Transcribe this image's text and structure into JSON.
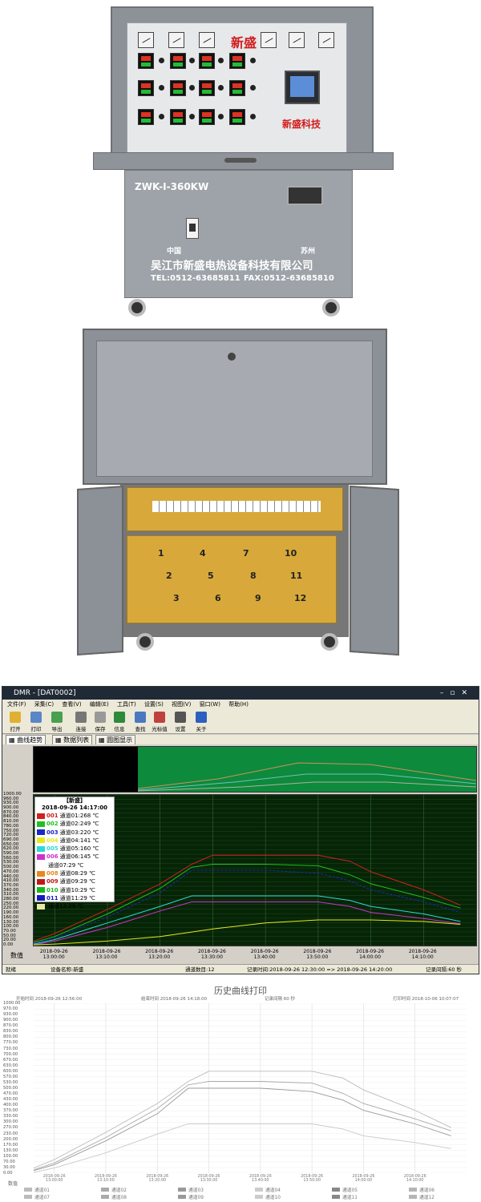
{
  "product": {
    "brand_tag": "新盛",
    "brand_panel": "新盛科技",
    "model": "ZWK-I-360KW",
    "origin_left": "中国",
    "origin_right": "苏州",
    "company": "吴江市新盛电热设备科技有限公司",
    "tel": "TEL:0512-63685811",
    "fax": "FAX:0512-63685810",
    "bay_numbers": [
      "1",
      "2",
      "3",
      "4",
      "5",
      "6",
      "7",
      "8",
      "9",
      "10",
      "11",
      "12"
    ]
  },
  "window": {
    "title": "DMR - [DAT0002]",
    "menus": [
      "文件(F)",
      "采集(C)",
      "查看(V)",
      "编辑(E)",
      "工具(T)",
      "设置(S)",
      "视图(V)",
      "窗口(W)",
      "帮助(H)"
    ],
    "toolbar": [
      {
        "label": "打开",
        "icon": "folder-open-icon",
        "color": "#e0b030"
      },
      {
        "label": "打印",
        "icon": "printer-icon",
        "color": "#5a86c8"
      },
      {
        "label": "导出",
        "icon": "export-icon",
        "color": "#48a050"
      },
      {
        "label": "连接",
        "icon": "connect-icon",
        "color": "#777777"
      },
      {
        "label": "保存",
        "icon": "save-icon",
        "color": "#999999"
      },
      {
        "label": "信息",
        "icon": "check-icon",
        "color": "#2c8a3a"
      },
      {
        "label": "查找",
        "icon": "search-icon",
        "color": "#4a78c0"
      },
      {
        "label": "光标值",
        "icon": "cursor-value-icon",
        "color": "#c04040"
      },
      {
        "label": "设置",
        "icon": "tools-icon",
        "color": "#555555"
      },
      {
        "label": "关于",
        "icon": "help-icon",
        "color": "#2d5fc0"
      }
    ],
    "tabs": [
      "曲线趋势",
      "数据列表",
      "圆图显示"
    ],
    "legend": {
      "title": "【新盛】",
      "time": "2018-09-26 14:17:00",
      "rows": [
        {
          "id": "001",
          "text": "通道01:268 ℃",
          "color": "#d02020"
        },
        {
          "id": "002",
          "text": "通道02:249 ℃",
          "color": "#20c020"
        },
        {
          "id": "003",
          "text": "通道03:220 ℃",
          "color": "#1828c8"
        },
        {
          "id": "004",
          "text": "通道04:141 ℃",
          "color": "#e8e820"
        },
        {
          "id": "005",
          "text": "通道05:160 ℃",
          "color": "#30d8d8"
        },
        {
          "id": "006",
          "text": "通道06:145 ℃",
          "color": "#d030d0"
        },
        {
          "id": "",
          "text": "通道07:29 ℃",
          "color": "#ffffff"
        },
        {
          "id": "008",
          "text": "通道08:29 ℃",
          "color": "#e88820"
        },
        {
          "id": "009",
          "text": "通道09:29 ℃",
          "color": "#c01818"
        },
        {
          "id": "010",
          "text": "通道10:29 ℃",
          "color": "#18b818"
        },
        {
          "id": "011",
          "text": "通道11:29 ℃",
          "color": "#1818c0"
        },
        {
          "id": "",
          "text": "通道12:29 ℃",
          "color": "#e8e8a0"
        }
      ]
    },
    "y_label": "数值",
    "status": {
      "ready": "就绪",
      "device": "设备名称:新盛",
      "channels": "通道数目:12",
      "record_time": "记录时间:2018-09-26 12:30:00 => 2018-09-26 14:20:00",
      "interval": "记录间隔:60 秒"
    }
  },
  "chart_data": [
    {
      "type": "line",
      "title": "",
      "ylabel": "数值",
      "ylim": [
        0,
        1000
      ],
      "y_ticks": [
        "1000.00",
        "960.00",
        "930.00",
        "900.00",
        "870.00",
        "840.00",
        "810.00",
        "780.00",
        "750.00",
        "720.00",
        "690.00",
        "650.00",
        "620.00",
        "590.00",
        "560.00",
        "530.00",
        "500.00",
        "470.00",
        "440.00",
        "410.00",
        "370.00",
        "340.00",
        "310.00",
        "280.00",
        "250.00",
        "220.00",
        "190.00",
        "160.00",
        "130.00",
        "100.00",
        "70.00",
        "50.00",
        "20.00",
        "0.00"
      ],
      "x_ticks": [
        {
          "d": "2018-09-26",
          "t": "13:00:00"
        },
        {
          "d": "2018-09-26",
          "t": "13:10:00"
        },
        {
          "d": "2018-09-26",
          "t": "13:20:00"
        },
        {
          "d": "2018-09-26",
          "t": "13:30:00"
        },
        {
          "d": "2018-09-26",
          "t": "13:40:00"
        },
        {
          "d": "2018-09-26",
          "t": "13:50:00"
        },
        {
          "d": "2018-09-26",
          "t": "14:00:00"
        },
        {
          "d": "2018-09-26",
          "t": "14:10:00"
        }
      ],
      "x": [
        "12:56",
        "13:00",
        "13:10",
        "13:20",
        "13:26",
        "13:30",
        "13:40",
        "13:50",
        "13:56",
        "14:00",
        "14:10",
        "14:17"
      ],
      "series": [
        {
          "color": "#d02020",
          "values": [
            30,
            80,
            240,
            410,
            540,
            600,
            600,
            600,
            560,
            490,
            370,
            268
          ]
        },
        {
          "color": "#20c020",
          "values": [
            20,
            60,
            210,
            380,
            520,
            540,
            540,
            530,
            470,
            410,
            320,
            249
          ]
        },
        {
          "color": "#1828c8",
          "values": [
            15,
            50,
            190,
            350,
            500,
            500,
            500,
            480,
            430,
            370,
            290,
            220
          ]
        },
        {
          "color": "#30d8d8",
          "values": [
            10,
            40,
            150,
            260,
            330,
            330,
            330,
            330,
            300,
            260,
            210,
            160
          ]
        },
        {
          "color": "#d030d0",
          "values": [
            5,
            30,
            120,
            230,
            290,
            290,
            290,
            290,
            260,
            220,
            180,
            145
          ]
        },
        {
          "color": "#e8e820",
          "values": [
            5,
            10,
            30,
            60,
            90,
            110,
            150,
            170,
            170,
            170,
            160,
            141
          ]
        }
      ]
    },
    {
      "type": "line",
      "title": "历史曲线打印",
      "ylim": [
        0,
        1000
      ],
      "y_ticks": [
        "1000.00",
        "970.00",
        "930.00",
        "900.00",
        "870.00",
        "830.00",
        "800.00",
        "770.00",
        "730.00",
        "700.00",
        "670.00",
        "630.00",
        "600.00",
        "570.00",
        "530.00",
        "500.00",
        "470.00",
        "430.00",
        "400.00",
        "370.00",
        "330.00",
        "300.00",
        "270.00",
        "230.00",
        "200.00",
        "170.00",
        "130.00",
        "100.00",
        "70.00",
        "30.00",
        "0.00"
      ],
      "x_ticks": [
        "2018-09-26 13:00:00",
        "2018-09-26 13:10:00",
        "2018-09-26 13:20:00",
        "2018-09-26 13:30:00",
        "2018-09-26 13:40:00",
        "2018-09-26 13:50:00",
        "2018-09-26 14:00:00",
        "2018-09-26 14:10:00"
      ],
      "x": [
        "12:56",
        "13:00",
        "13:10",
        "13:20",
        "13:26",
        "13:30",
        "13:40",
        "13:50",
        "13:56",
        "14:00",
        "14:10",
        "14:17"
      ],
      "series": [
        {
          "color": "#bbbbbb",
          "values": [
            30,
            80,
            240,
            410,
            540,
            600,
            600,
            600,
            560,
            490,
            370,
            268
          ]
        },
        {
          "color": "#aaaaaa",
          "values": [
            20,
            60,
            210,
            380,
            520,
            540,
            540,
            530,
            470,
            410,
            320,
            249
          ]
        },
        {
          "color": "#999999",
          "values": [
            15,
            50,
            190,
            350,
            500,
            500,
            500,
            480,
            430,
            370,
            290,
            220
          ]
        },
        {
          "color": "#c8c8c8",
          "values": [
            5,
            30,
            120,
            230,
            290,
            290,
            290,
            290,
            260,
            220,
            180,
            145
          ]
        }
      ]
    }
  ],
  "print": {
    "title": "历史曲线打印",
    "start": "开始时间 2018-09-26 12:56:00",
    "end": "结束时间 2018-09-26 14:18:00",
    "interval": "记录间隔 60 秒",
    "print_time": "打印时间 2018-10-06 10:07:07",
    "y_label": "数值",
    "legend": [
      "通道01",
      "通道02",
      "通道03",
      "通道04",
      "通道05",
      "通道06",
      "通道07",
      "通道08",
      "通道09",
      "通道10",
      "通道11",
      "通道12"
    ]
  }
}
